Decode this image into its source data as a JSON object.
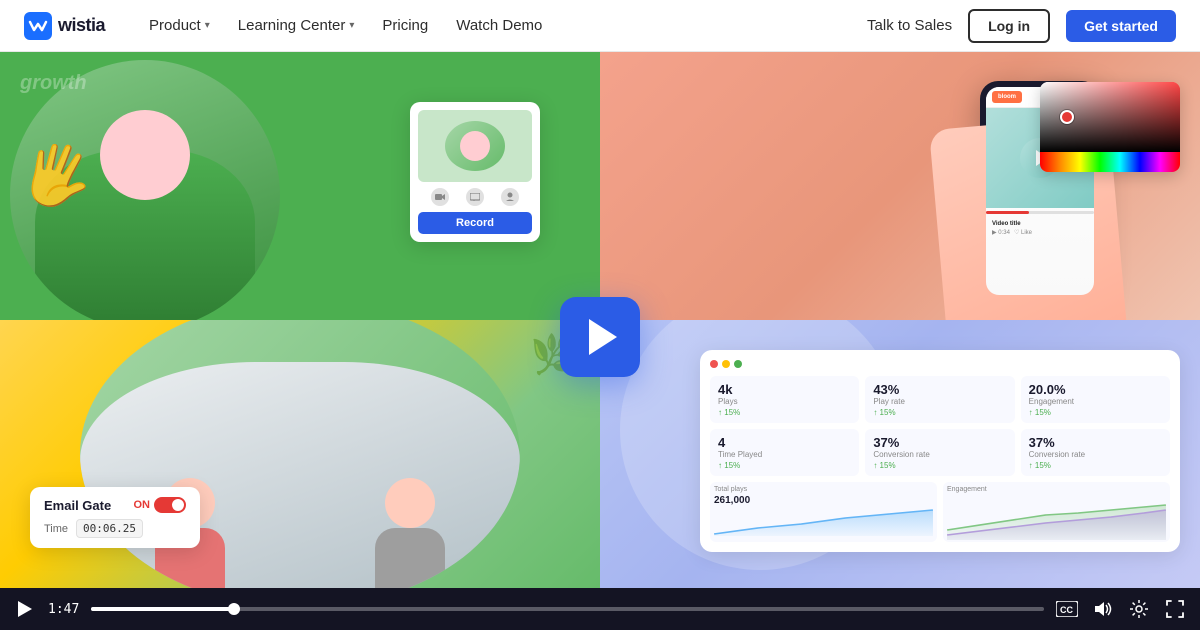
{
  "brand": {
    "name": "wistia",
    "logo_icon": "≋",
    "accent_color": "#2B5CE6"
  },
  "navbar": {
    "logo_text": "wistia",
    "product_label": "Product",
    "learning_center_label": "Learning Center",
    "pricing_label": "Pricing",
    "watch_demo_label": "Watch Demo",
    "talk_to_sales_label": "Talk to Sales",
    "login_label": "Log in",
    "get_started_label": "Get started"
  },
  "video": {
    "duration": "1:47",
    "current_time": "1:47",
    "progress_percent": 15
  },
  "record_widget": {
    "button_label": "Record"
  },
  "email_gate_widget": {
    "title": "Email Gate",
    "toggle_label": "ON",
    "time_label": "Time",
    "time_value": "00:06.25"
  },
  "analytics": {
    "stat1_value": "4k",
    "stat1_label": "Plays",
    "stat1_change": "↑ 15%",
    "stat2_value": "43%",
    "stat2_label": "Play rate",
    "stat2_change": "↑ 15%",
    "stat3_value": "20.0%",
    "stat3_label": "Engagement",
    "stat3_change": "↑ 15%",
    "stat4_value": "4",
    "stat4_label": "Time Played",
    "stat4_change": "↑ 15%",
    "stat5_value": "37%",
    "stat5_label": "Conversion rate",
    "stat5_change": "↑ 15%",
    "stat6_value": "37%",
    "stat6_label": "Conversion rate",
    "stat6_change": "↑ 15%",
    "total_plays": "261,000",
    "total_plays_label": "Total plays"
  },
  "controls": {
    "cc_icon": "CC",
    "volume_icon": "🔊",
    "settings_icon": "⚙",
    "fullscreen_icon": "⛶"
  }
}
